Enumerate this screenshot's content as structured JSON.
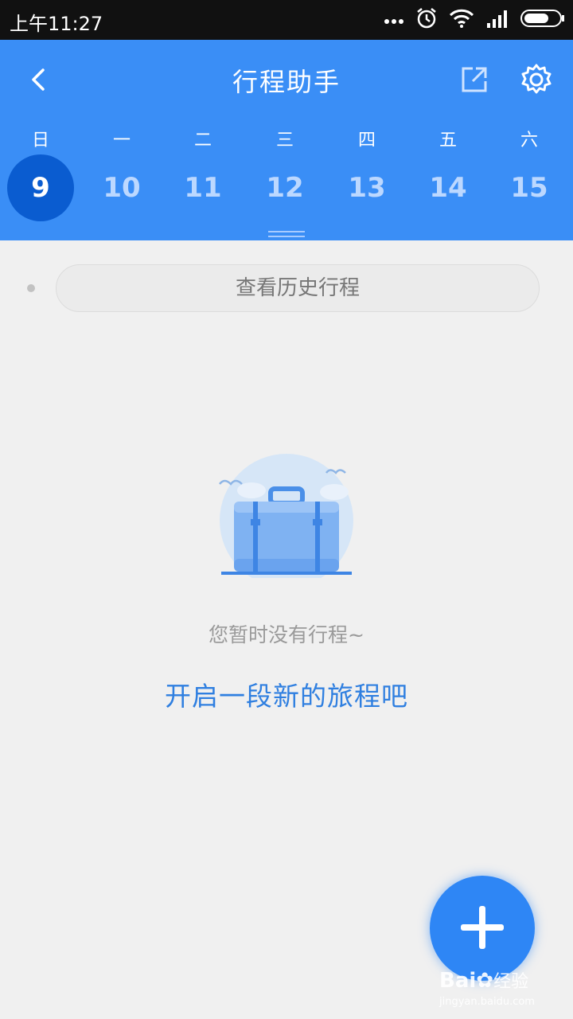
{
  "status_bar": {
    "time": "上午11:27",
    "icons": [
      "more-dots-icon",
      "alarm-icon",
      "wifi-icon",
      "signal-icon",
      "battery-icon"
    ]
  },
  "header": {
    "title": "行程助手",
    "background_color": "#3a8ef6"
  },
  "week": {
    "days": [
      {
        "weekday": "日",
        "date": "9",
        "selected": true
      },
      {
        "weekday": "一",
        "date": "10",
        "selected": false
      },
      {
        "weekday": "二",
        "date": "11",
        "selected": false
      },
      {
        "weekday": "三",
        "date": "12",
        "selected": false
      },
      {
        "weekday": "四",
        "date": "13",
        "selected": false
      },
      {
        "weekday": "五",
        "date": "14",
        "selected": false
      },
      {
        "weekday": "六",
        "date": "15",
        "selected": false
      }
    ],
    "selected_color": "#0a5cd0"
  },
  "history": {
    "label": "查看历史行程"
  },
  "empty_state": {
    "illustration": "suitcase-icon",
    "message": "您暂时没有行程~",
    "action_label": "开启一段新的旅程吧",
    "action_color": "#2f7fe0"
  },
  "fab": {
    "icon": "plus-icon",
    "color": "#2e86f5"
  },
  "watermark": {
    "brand": "Bai",
    "brand_tail": "经验",
    "url": "jingyan.baidu.com"
  }
}
